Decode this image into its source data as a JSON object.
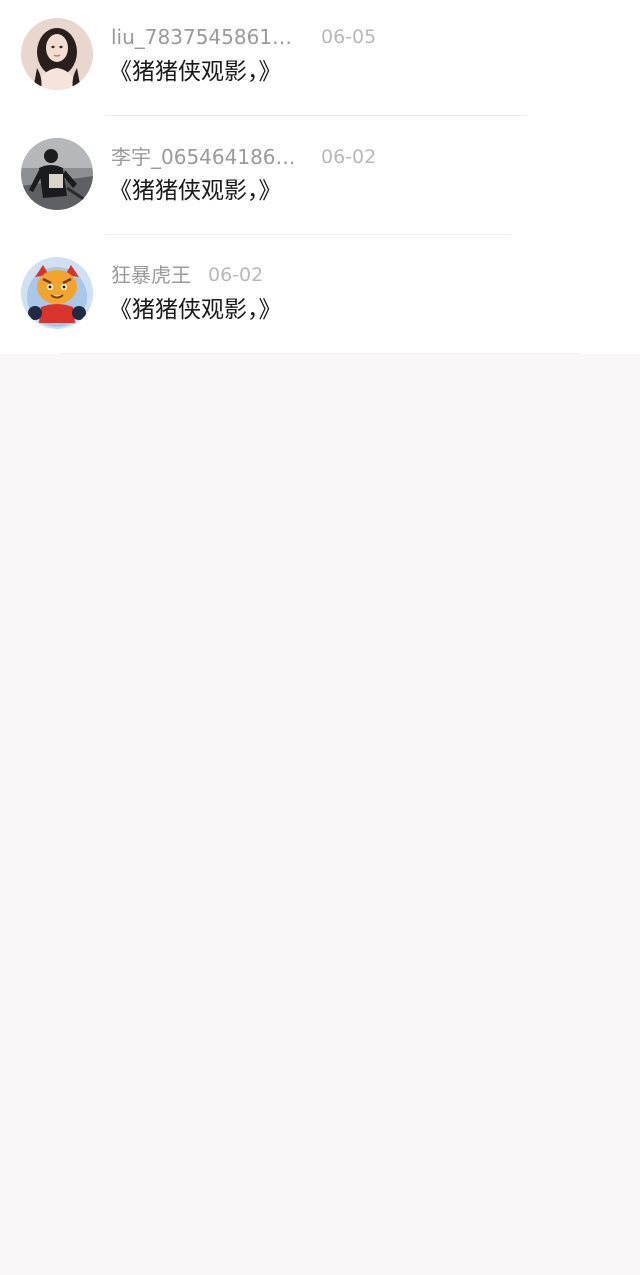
{
  "comments": [
    {
      "username": "liu_783754586106...",
      "date": "06-05",
      "text": "《猪猪侠观影，》",
      "avatar_icon": "woman-portrait-avatar-icon"
    },
    {
      "username": "李宇_0654641864...",
      "date": "06-02",
      "text": "《猪猪侠观影，》",
      "avatar_icon": "man-photo-avatar-icon"
    },
    {
      "username": "狂暴虎王",
      "date": "06-02",
      "text": "《猪猪侠观影，》",
      "avatar_icon": "cartoon-tiger-avatar-icon"
    }
  ]
}
